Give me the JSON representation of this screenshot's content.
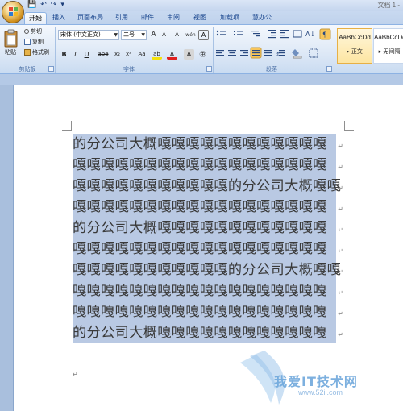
{
  "window": {
    "title": "文档 1 - ",
    "qat": [
      "💾",
      "↶",
      "↷",
      "▾"
    ]
  },
  "tabs": [
    "开始",
    "插入",
    "页面布局",
    "引用",
    "邮件",
    "审阅",
    "视图",
    "加载项",
    "慧办公"
  ],
  "active_tab": "开始",
  "clipboard": {
    "paste_label": "粘贴",
    "cut_label": "剪切",
    "copy_label": "复制",
    "format_painter_label": "格式刷",
    "group_label": "剪贴板"
  },
  "font": {
    "name": "宋体 (中文正文)",
    "size": "二号",
    "group_label": "字体",
    "grow": "A",
    "shrink": "A",
    "bold": "B",
    "italic": "I",
    "underline": "U",
    "strike": "abe",
    "subscript": "x₂",
    "superscript": "x²",
    "change_case": "Aa",
    "highlight": "ab",
    "font_color": "A",
    "char_border": "A",
    "enclosed": "㊥",
    "clear": "A",
    "phonetic": "wén",
    "font_color_hex": "#e02020",
    "highlight_hex": "#f4e10d"
  },
  "paragraph": {
    "group_label": "段落"
  },
  "styles": {
    "items": [
      {
        "sample": "AaBbCcDd",
        "name": "▸ 正文"
      },
      {
        "sample": "AaBbCcDd",
        "name": "▸ 无间隔"
      }
    ]
  },
  "document": {
    "lines": [
      "的分公司大概嘎嘎嘎嘎嘎嘎嘎嘎嘎嘎嘎嘎",
      "嘎嘎嘎嘎嘎嘎嘎嘎嘎嘎嘎嘎嘎嘎嘎嘎嘎嘎",
      "嘎嘎嘎嘎嘎嘎嘎嘎嘎嘎嘎的分公司大概嘎嘎",
      "嘎嘎嘎嘎嘎嘎嘎嘎嘎嘎嘎嘎嘎嘎嘎嘎嘎嘎",
      "的分公司大概嘎嘎嘎嘎嘎嘎嘎嘎嘎嘎嘎嘎",
      "嘎嘎嘎嘎嘎嘎嘎嘎嘎嘎嘎嘎嘎嘎嘎嘎嘎嘎",
      "嘎嘎嘎嘎嘎嘎嘎嘎嘎嘎嘎的分公司大概嘎嘎",
      "嘎嘎嘎嘎嘎嘎嘎嘎嘎嘎嘎嘎嘎嘎嘎嘎嘎嘎",
      "嘎嘎嘎嘎嘎嘎嘎嘎嘎嘎嘎嘎嘎嘎嘎嘎嘎嘎",
      "的分公司大概嘎嘎嘎嘎嘎嘎嘎嘎嘎嘎嘎嘎"
    ],
    "para_mark": "↵",
    "selection_color": "#b9c9e3"
  },
  "watermark": {
    "title": "我爱IT技术网",
    "url": "www.52ij.com"
  }
}
